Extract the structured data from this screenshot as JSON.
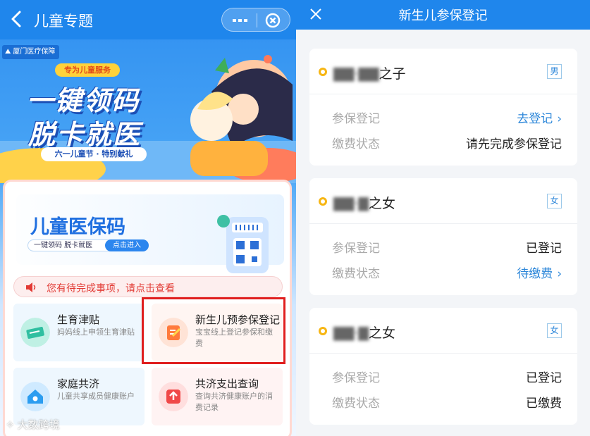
{
  "left": {
    "header": {
      "title": "儿童专题"
    },
    "brand": "厦门医疗保障",
    "banner": {
      "ribbon": "专为儿童服务",
      "headline_line1": "一键领码",
      "headline_line2": "脱卡就医",
      "subtitle": "六一儿童节 · 特别献礼"
    },
    "code_card": {
      "title": "儿童医保码",
      "slogan": "一键领码 脱卡就医",
      "enter_button": "点击进入"
    },
    "notice": "您有待完成事项，请点击查看",
    "services": [
      {
        "title": "生育津贴",
        "desc": "妈妈线上申领生育津贴",
        "icon": "ticket-icon"
      },
      {
        "title": "新生儿预参保登记",
        "desc": "宝宝线上登记参保和缴费",
        "icon": "register-icon"
      },
      {
        "title": "家庭共济",
        "desc": "儿童共享成员健康账户",
        "icon": "home-icon"
      },
      {
        "title": "共济支出查询",
        "desc": "查询共济健康账户的消费记录",
        "icon": "upload-icon"
      }
    ],
    "watermark": "大数跨境"
  },
  "right": {
    "header": {
      "title": "新生儿参保登记"
    },
    "children": [
      {
        "name_blurred": "▇▇·▇▇",
        "name_suffix": "之子",
        "gender": "男",
        "rows": [
          {
            "label": "参保登记",
            "value": "去登记",
            "link": true
          },
          {
            "label": "缴费状态",
            "value": "请先完成参保登记",
            "link": false
          }
        ]
      },
      {
        "name_blurred": "▇▇·▇",
        "name_suffix": "之女",
        "gender": "女",
        "rows": [
          {
            "label": "参保登记",
            "value": "已登记",
            "link": false
          },
          {
            "label": "缴费状态",
            "value": "待缴费",
            "link": true
          }
        ]
      },
      {
        "name_blurred": "▇▇·▇",
        "name_suffix": "之女",
        "gender": "女",
        "rows": [
          {
            "label": "参保登记",
            "value": "已登记",
            "link": false
          },
          {
            "label": "缴费状态",
            "value": "已缴费",
            "link": false
          }
        ]
      }
    ]
  },
  "colors": {
    "primary": "#1f86ec",
    "accent_red": "#e01e1e",
    "link": "#2b86d9",
    "dot": "#f7b613"
  }
}
